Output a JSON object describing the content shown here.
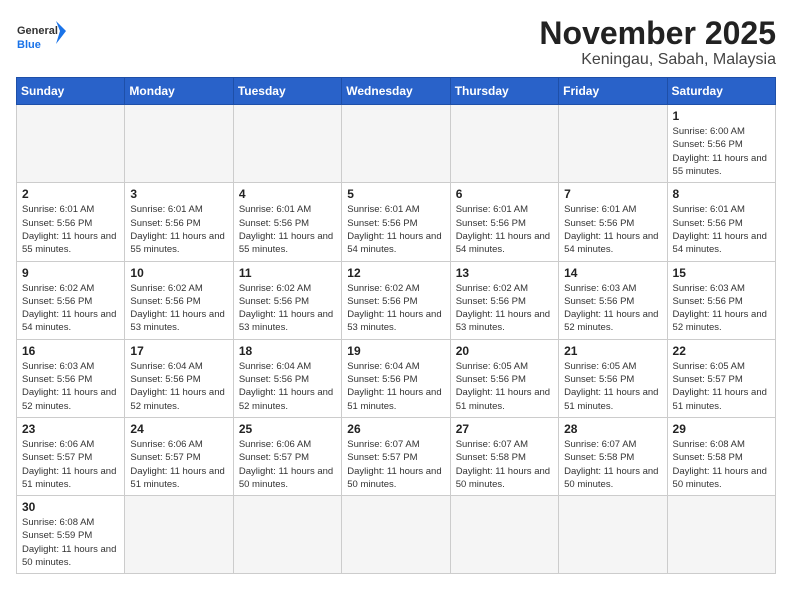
{
  "logo": {
    "general": "General",
    "blue": "Blue"
  },
  "header": {
    "month": "November 2025",
    "location": "Keningau, Sabah, Malaysia"
  },
  "weekdays": [
    "Sunday",
    "Monday",
    "Tuesday",
    "Wednesday",
    "Thursday",
    "Friday",
    "Saturday"
  ],
  "weeks": [
    [
      {
        "day": "",
        "empty": true
      },
      {
        "day": "",
        "empty": true
      },
      {
        "day": "",
        "empty": true
      },
      {
        "day": "",
        "empty": true
      },
      {
        "day": "",
        "empty": true
      },
      {
        "day": "",
        "empty": true
      },
      {
        "day": "1",
        "sunrise": "Sunrise: 6:00 AM",
        "sunset": "Sunset: 5:56 PM",
        "daylight": "Daylight: 11 hours and 55 minutes."
      }
    ],
    [
      {
        "day": "2",
        "sunrise": "Sunrise: 6:01 AM",
        "sunset": "Sunset: 5:56 PM",
        "daylight": "Daylight: 11 hours and 55 minutes."
      },
      {
        "day": "3",
        "sunrise": "Sunrise: 6:01 AM",
        "sunset": "Sunset: 5:56 PM",
        "daylight": "Daylight: 11 hours and 55 minutes."
      },
      {
        "day": "4",
        "sunrise": "Sunrise: 6:01 AM",
        "sunset": "Sunset: 5:56 PM",
        "daylight": "Daylight: 11 hours and 55 minutes."
      },
      {
        "day": "5",
        "sunrise": "Sunrise: 6:01 AM",
        "sunset": "Sunset: 5:56 PM",
        "daylight": "Daylight: 11 hours and 54 minutes."
      },
      {
        "day": "6",
        "sunrise": "Sunrise: 6:01 AM",
        "sunset": "Sunset: 5:56 PM",
        "daylight": "Daylight: 11 hours and 54 minutes."
      },
      {
        "day": "7",
        "sunrise": "Sunrise: 6:01 AM",
        "sunset": "Sunset: 5:56 PM",
        "daylight": "Daylight: 11 hours and 54 minutes."
      },
      {
        "day": "8",
        "sunrise": "Sunrise: 6:01 AM",
        "sunset": "Sunset: 5:56 PM",
        "daylight": "Daylight: 11 hours and 54 minutes."
      }
    ],
    [
      {
        "day": "9",
        "sunrise": "Sunrise: 6:02 AM",
        "sunset": "Sunset: 5:56 PM",
        "daylight": "Daylight: 11 hours and 54 minutes."
      },
      {
        "day": "10",
        "sunrise": "Sunrise: 6:02 AM",
        "sunset": "Sunset: 5:56 PM",
        "daylight": "Daylight: 11 hours and 53 minutes."
      },
      {
        "day": "11",
        "sunrise": "Sunrise: 6:02 AM",
        "sunset": "Sunset: 5:56 PM",
        "daylight": "Daylight: 11 hours and 53 minutes."
      },
      {
        "day": "12",
        "sunrise": "Sunrise: 6:02 AM",
        "sunset": "Sunset: 5:56 PM",
        "daylight": "Daylight: 11 hours and 53 minutes."
      },
      {
        "day": "13",
        "sunrise": "Sunrise: 6:02 AM",
        "sunset": "Sunset: 5:56 PM",
        "daylight": "Daylight: 11 hours and 53 minutes."
      },
      {
        "day": "14",
        "sunrise": "Sunrise: 6:03 AM",
        "sunset": "Sunset: 5:56 PM",
        "daylight": "Daylight: 11 hours and 52 minutes."
      },
      {
        "day": "15",
        "sunrise": "Sunrise: 6:03 AM",
        "sunset": "Sunset: 5:56 PM",
        "daylight": "Daylight: 11 hours and 52 minutes."
      }
    ],
    [
      {
        "day": "16",
        "sunrise": "Sunrise: 6:03 AM",
        "sunset": "Sunset: 5:56 PM",
        "daylight": "Daylight: 11 hours and 52 minutes."
      },
      {
        "day": "17",
        "sunrise": "Sunrise: 6:04 AM",
        "sunset": "Sunset: 5:56 PM",
        "daylight": "Daylight: 11 hours and 52 minutes."
      },
      {
        "day": "18",
        "sunrise": "Sunrise: 6:04 AM",
        "sunset": "Sunset: 5:56 PM",
        "daylight": "Daylight: 11 hours and 52 minutes."
      },
      {
        "day": "19",
        "sunrise": "Sunrise: 6:04 AM",
        "sunset": "Sunset: 5:56 PM",
        "daylight": "Daylight: 11 hours and 51 minutes."
      },
      {
        "day": "20",
        "sunrise": "Sunrise: 6:05 AM",
        "sunset": "Sunset: 5:56 PM",
        "daylight": "Daylight: 11 hours and 51 minutes."
      },
      {
        "day": "21",
        "sunrise": "Sunrise: 6:05 AM",
        "sunset": "Sunset: 5:56 PM",
        "daylight": "Daylight: 11 hours and 51 minutes."
      },
      {
        "day": "22",
        "sunrise": "Sunrise: 6:05 AM",
        "sunset": "Sunset: 5:57 PM",
        "daylight": "Daylight: 11 hours and 51 minutes."
      }
    ],
    [
      {
        "day": "23",
        "sunrise": "Sunrise: 6:06 AM",
        "sunset": "Sunset: 5:57 PM",
        "daylight": "Daylight: 11 hours and 51 minutes."
      },
      {
        "day": "24",
        "sunrise": "Sunrise: 6:06 AM",
        "sunset": "Sunset: 5:57 PM",
        "daylight": "Daylight: 11 hours and 51 minutes."
      },
      {
        "day": "25",
        "sunrise": "Sunrise: 6:06 AM",
        "sunset": "Sunset: 5:57 PM",
        "daylight": "Daylight: 11 hours and 50 minutes."
      },
      {
        "day": "26",
        "sunrise": "Sunrise: 6:07 AM",
        "sunset": "Sunset: 5:57 PM",
        "daylight": "Daylight: 11 hours and 50 minutes."
      },
      {
        "day": "27",
        "sunrise": "Sunrise: 6:07 AM",
        "sunset": "Sunset: 5:58 PM",
        "daylight": "Daylight: 11 hours and 50 minutes."
      },
      {
        "day": "28",
        "sunrise": "Sunrise: 6:07 AM",
        "sunset": "Sunset: 5:58 PM",
        "daylight": "Daylight: 11 hours and 50 minutes."
      },
      {
        "day": "29",
        "sunrise": "Sunrise: 6:08 AM",
        "sunset": "Sunset: 5:58 PM",
        "daylight": "Daylight: 11 hours and 50 minutes."
      }
    ],
    [
      {
        "day": "30",
        "sunrise": "Sunrise: 6:08 AM",
        "sunset": "Sunset: 5:59 PM",
        "daylight": "Daylight: 11 hours and 50 minutes."
      },
      {
        "day": "",
        "empty": true
      },
      {
        "day": "",
        "empty": true
      },
      {
        "day": "",
        "empty": true
      },
      {
        "day": "",
        "empty": true
      },
      {
        "day": "",
        "empty": true
      },
      {
        "day": "",
        "empty": true
      }
    ]
  ]
}
